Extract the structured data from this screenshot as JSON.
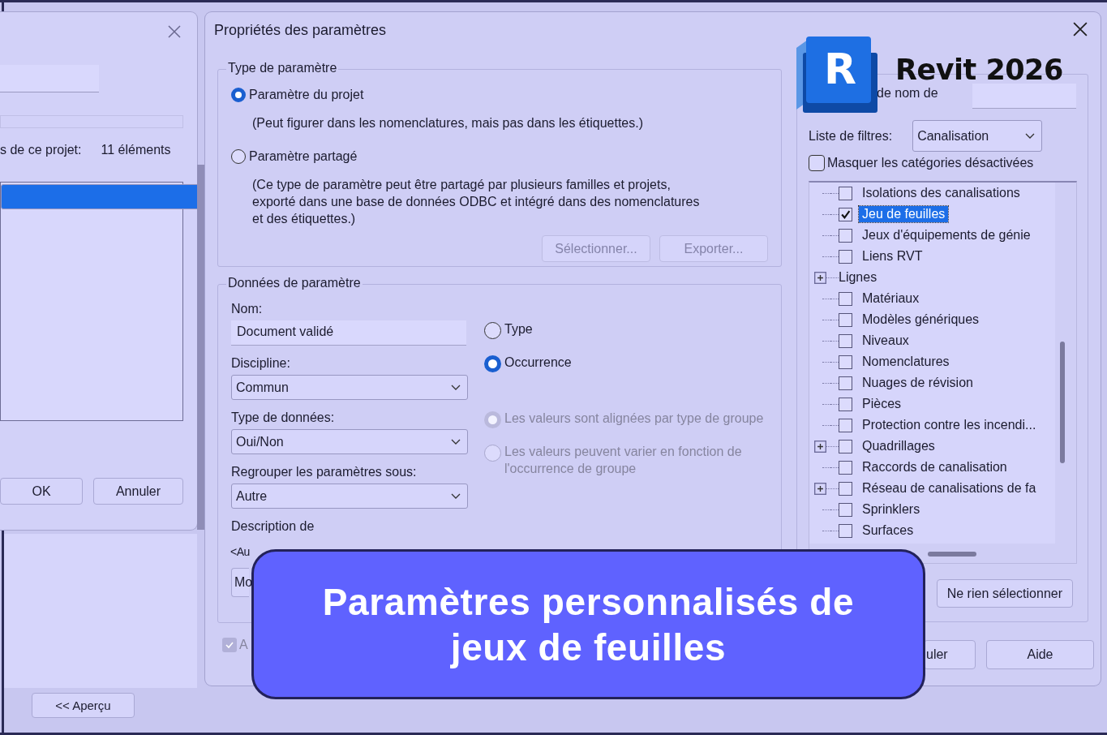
{
  "back_dialog": {
    "count_label": "s de ce projet:",
    "count": "11 éléments",
    "list_rows": [
      {
        "selected": true
      }
    ],
    "buttons": [
      "OK",
      "Annuler"
    ]
  },
  "footer_button": "<< Aperçu",
  "dialog": {
    "title": "Propriétés des paramètres",
    "parameter_type": {
      "legend": "Type de paramètre",
      "options": [
        {
          "label": "Paramètre du projet",
          "selected": true,
          "description": "(Peut figurer dans les nomenclatures, mais pas dans les étiquettes.)"
        },
        {
          "label": "Paramètre partagé",
          "selected": false,
          "description": "(Ce type de paramètre peut être partagé par plusieurs familles et projets, exporté dans une base de données ODBC et intégré dans des nomenclatures et des étiquettes.)"
        }
      ],
      "buttons": [
        {
          "label": "Sélectionner...",
          "disabled": true
        },
        {
          "label": "Exporter...",
          "disabled": true
        }
      ]
    },
    "parameter_data": {
      "legend": "Données de paramètre",
      "name_label": "Nom:",
      "name_value": "Document validé",
      "selects": [
        {
          "label": "Discipline:",
          "value": "Commun"
        },
        {
          "label": "Type de données:",
          "value": "Oui/Non"
        },
        {
          "label": "Regrouper les paramètres sous:",
          "value": "Autre"
        }
      ],
      "description_label": "Description de",
      "description_value": "<Au",
      "description_button": "Mo",
      "binding": [
        {
          "label": "Type",
          "selected": false
        },
        {
          "label": "Occurrence",
          "selected": true
        }
      ],
      "group_values": [
        {
          "label": "Les valeurs sont alignées par type de groupe",
          "selected": true,
          "disabled": true
        },
        {
          "label": "Les valeurs peuvent varier en fonction de l'occurrence de groupe",
          "selected": false,
          "disabled": true
        }
      ]
    },
    "bottom_checkbox": {
      "label": "A",
      "checked": true,
      "disabled": true
    },
    "categories": {
      "name_filter_label": "de nom de",
      "filter_label": "Liste de filtres:",
      "filter_value": "Canalisation",
      "hide_label": "Masquer les catégories désactivées",
      "hide_checked": false,
      "items": [
        {
          "label": "Isolations des canalisations",
          "kind": "category",
          "checked": false,
          "selected": false,
          "expandable": false
        },
        {
          "label": "Jeu de feuilles",
          "kind": "category",
          "checked": true,
          "selected": true,
          "expandable": false
        },
        {
          "label": "Jeux d'équipements de génie",
          "kind": "category",
          "checked": false,
          "selected": false,
          "expandable": false
        },
        {
          "label": "Liens RVT",
          "kind": "category",
          "checked": false,
          "selected": false,
          "expandable": false
        },
        {
          "label": "Lignes",
          "kind": "group",
          "selected": false,
          "expandable": true
        },
        {
          "label": "Matériaux",
          "kind": "category",
          "checked": false,
          "selected": false,
          "expandable": false
        },
        {
          "label": "Modèles génériques",
          "kind": "category",
          "checked": false,
          "selected": false,
          "expandable": false
        },
        {
          "label": "Niveaux",
          "kind": "category",
          "checked": false,
          "selected": false,
          "expandable": false
        },
        {
          "label": "Nomenclatures",
          "kind": "category",
          "checked": false,
          "selected": false,
          "expandable": false
        },
        {
          "label": "Nuages de révision",
          "kind": "category",
          "checked": false,
          "selected": false,
          "expandable": false
        },
        {
          "label": "Pièces",
          "kind": "category",
          "checked": false,
          "selected": false,
          "expandable": false
        },
        {
          "label": "Protection contre les incendi...",
          "kind": "category",
          "checked": false,
          "selected": false,
          "expandable": false
        },
        {
          "label": "Quadrillages",
          "kind": "category",
          "checked": false,
          "selected": false,
          "expandable": true
        },
        {
          "label": "Raccords de canalisation",
          "kind": "category",
          "checked": false,
          "selected": false,
          "expandable": false
        },
        {
          "label": "Réseau de canalisations de fa",
          "kind": "category",
          "checked": false,
          "selected": false,
          "expandable": true
        },
        {
          "label": "Sprinklers",
          "kind": "category",
          "checked": false,
          "selected": false,
          "expandable": false
        },
        {
          "label": "Surfaces",
          "kind": "category",
          "checked": false,
          "selected": false,
          "expandable": false
        }
      ],
      "clear_button": "Ne rien sélectionner"
    },
    "buttons": [
      "uler",
      "Aide"
    ]
  },
  "logo": {
    "letter": "R",
    "text": "Revit 2026"
  },
  "banner": {
    "title": "Paramètres personnalisés de jeux de feuilles"
  }
}
